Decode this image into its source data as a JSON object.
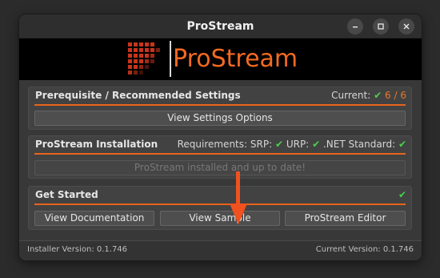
{
  "window": {
    "title": "ProStream",
    "controls": [
      "minimize-icon",
      "maximize-icon",
      "close-icon"
    ]
  },
  "banner": {
    "logo_text": "ProStream",
    "brand_color": "#f36a22"
  },
  "sections": {
    "prereq": {
      "title": "Prerequisite / Recommended Settings",
      "current_label": "Current:",
      "current_value": "6",
      "separator": "/",
      "total_value": "6",
      "button": "View Settings Options"
    },
    "install": {
      "title": "ProStream Installation",
      "requirements_label": "Requirements:",
      "srp_label": "SRP:",
      "urp_label": "URP:",
      "netstd_label": ".NET Standard:",
      "button": "ProStream installed and up to date!"
    },
    "started": {
      "title": "Get Started",
      "buttons": [
        "View Documentation",
        "View Sample",
        "ProStream Editor"
      ]
    }
  },
  "status": {
    "installer": "Installer Version: 0.1.746",
    "current": "Current Version: 0.1.746"
  },
  "icons": {
    "check": "✔",
    "check_color": "#4bd14b",
    "accent": "#e8641c",
    "arrow_color": "#f0511f"
  }
}
